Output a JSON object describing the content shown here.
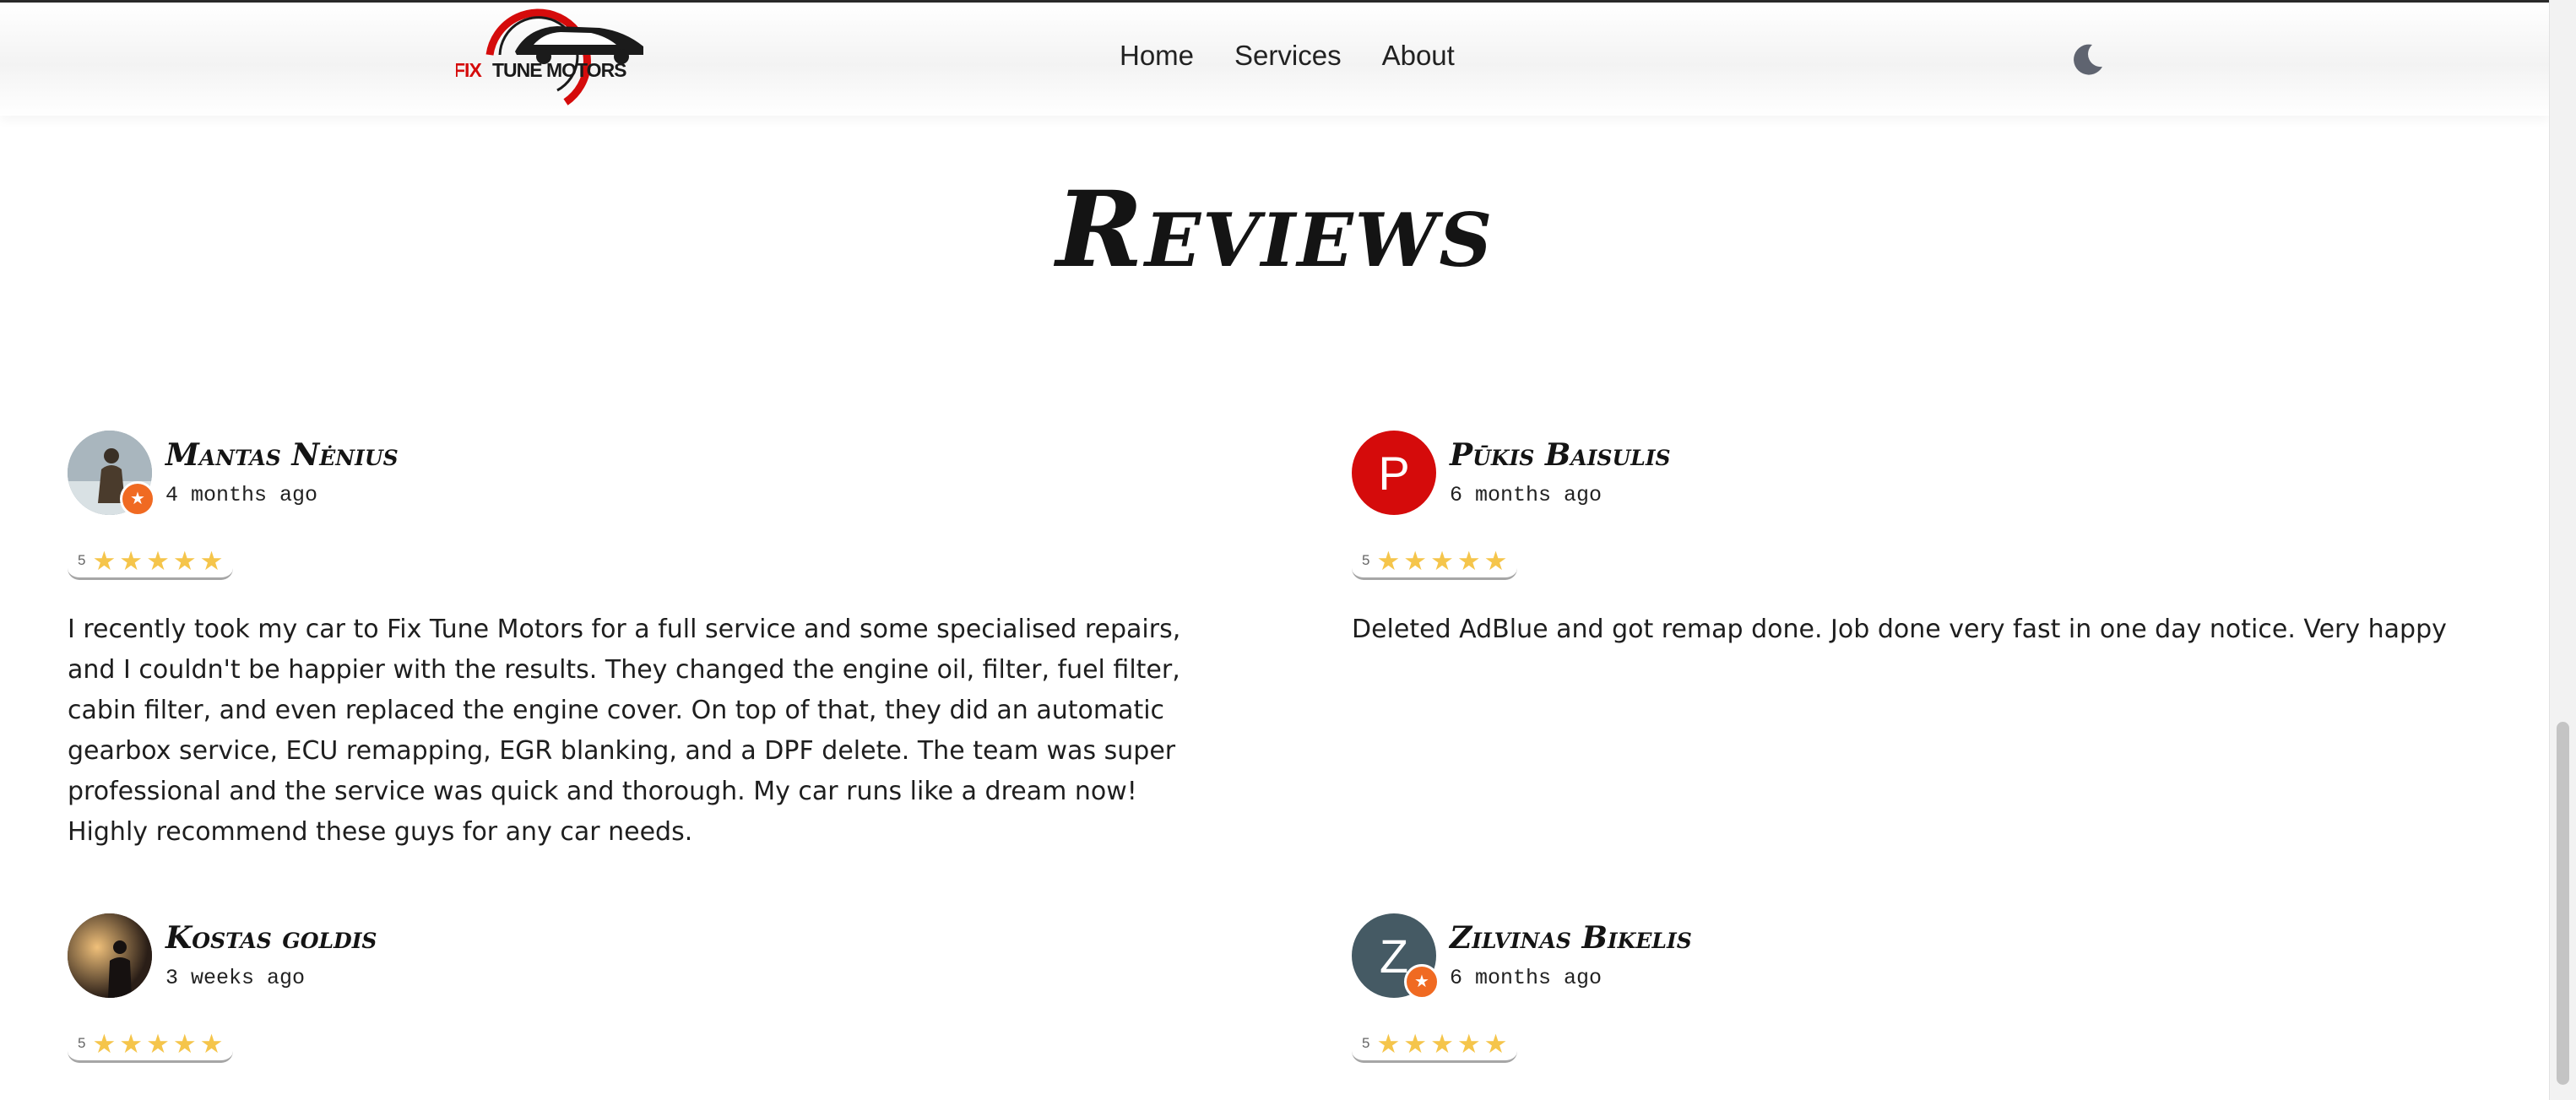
{
  "header": {
    "logo_text": "FIX TUNE MOTORS",
    "nav": [
      "Home",
      "Services",
      "About"
    ],
    "theme_toggle_icon": "moon-icon"
  },
  "section_title": "Reviews",
  "reviews": [
    {
      "name": "Mantas Nėnius",
      "time": "4 months ago",
      "rating": "5",
      "avatar": "photo",
      "avatar_color": "#8a9aa6",
      "text": "I recently took my car to Fix Tune Motors for a full service and some specialised repairs, and I couldn't be happier with the results. They changed the engine oil, filter, fuel filter, cabin filter, and even replaced the engine cover. On top of that, they did an automatic gearbox service, ECU remapping, EGR blanking, and a DPF delete. The team was super professional and the service was quick and thorough. My car runs like a dream now! Highly recommend these guys for any car needs."
    },
    {
      "name": "Pūkis Baisulis",
      "time": "6 months ago",
      "rating": "5",
      "avatar": "letter",
      "letter": "P",
      "avatar_color": "#d50b0b",
      "text": "Deleted AdBlue and got remap done. Job done very fast in one day notice. Very happy"
    },
    {
      "name": "Kostas goldis",
      "time": "3 weeks ago",
      "rating": "5",
      "avatar": "photo",
      "avatar_color": "#3a2c22",
      "text": ""
    },
    {
      "name": "Zilvinas Bikelis",
      "time": "6 months ago",
      "rating": "5",
      "avatar": "letter",
      "letter": "Z",
      "avatar_color": "#455a64",
      "text": ""
    }
  ],
  "colors": {
    "accent_red": "#d50b0b",
    "star": "#f5c54b",
    "badge": "#f06a22"
  }
}
